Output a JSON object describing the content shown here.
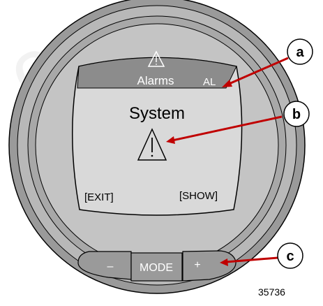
{
  "screen": {
    "header": {
      "title": "Alarms",
      "indicator": "AL",
      "warning_icon": "warning-triangle-icon"
    },
    "message": "System",
    "center_icon": "warning-triangle-icon",
    "soft_keys": {
      "left": "[EXIT]",
      "right": "[SHOW]"
    }
  },
  "buttons": {
    "minus": "–",
    "mode": "MODE",
    "plus": "+"
  },
  "callouts": [
    {
      "letter": "a"
    },
    {
      "letter": "b"
    },
    {
      "letter": "c"
    }
  ],
  "figure_number": "35736",
  "watermark": "co",
  "colors": {
    "bezel_outer": "#9a9a9a",
    "bezel_mid": "#b5b5b5",
    "bezel_inner": "#c9c9c9",
    "lcd_background": "#d9d9d9",
    "header_band": "#8c8c8c",
    "arrow": "#c00000",
    "outline": "#000000"
  }
}
